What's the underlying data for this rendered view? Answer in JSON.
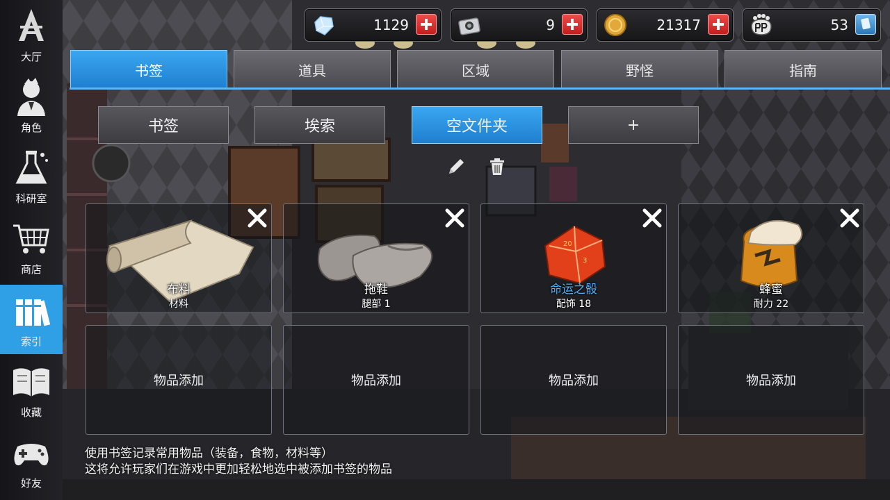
{
  "nav": [
    {
      "label": "大厅",
      "icon": "lobby-logo-icon"
    },
    {
      "label": "角色",
      "icon": "character-icon"
    },
    {
      "label": "科研室",
      "icon": "flask-icon"
    },
    {
      "label": "商店",
      "icon": "cart-icon"
    },
    {
      "label": "索引",
      "icon": "books-icon",
      "active": true
    },
    {
      "label": "收藏",
      "icon": "open-book-icon"
    },
    {
      "label": "好友",
      "icon": "gamepad-icon"
    }
  ],
  "currencies": [
    {
      "name": "crystal",
      "value": "1129",
      "icon": "crystal-icon"
    },
    {
      "name": "ticket",
      "value": "9",
      "icon": "ticket-icon"
    },
    {
      "name": "gold",
      "value": "21317",
      "icon": "gold-coin-icon"
    },
    {
      "name": "bp",
      "value": "53",
      "icon": "bp-paw-icon"
    }
  ],
  "tabs": [
    "书签",
    "道具",
    "区域",
    "野怪",
    "指南"
  ],
  "active_tab": "书签",
  "subtabs": [
    "书签",
    "埃索",
    "空文件夹",
    "+"
  ],
  "active_subtab": "空文件夹",
  "items": [
    {
      "name": "布料",
      "category": "材料",
      "icon": "cloth-roll-icon",
      "name_color": "white"
    },
    {
      "name": "拖鞋",
      "category": "腿部 1",
      "icon": "slippers-icon",
      "name_color": "white"
    },
    {
      "name": "命运之骰",
      "category": "配饰 18",
      "icon": "dice-icon",
      "name_color": "#4fb2ff"
    },
    {
      "name": "蜂蜜",
      "category": "耐力 22",
      "icon": "honey-jar-icon",
      "name_color": "white"
    }
  ],
  "empty_slot_label": "物品添加",
  "hint": {
    "line1": "使用书签记录常用物品（装备，食物，材料等）",
    "line2": "这将允许玩家们在游戏中更加轻松地选中被添加书签的物品"
  },
  "colors": {
    "accent": "#2f9fe6",
    "close": "#ffffff",
    "plus": "#d72a2a"
  }
}
